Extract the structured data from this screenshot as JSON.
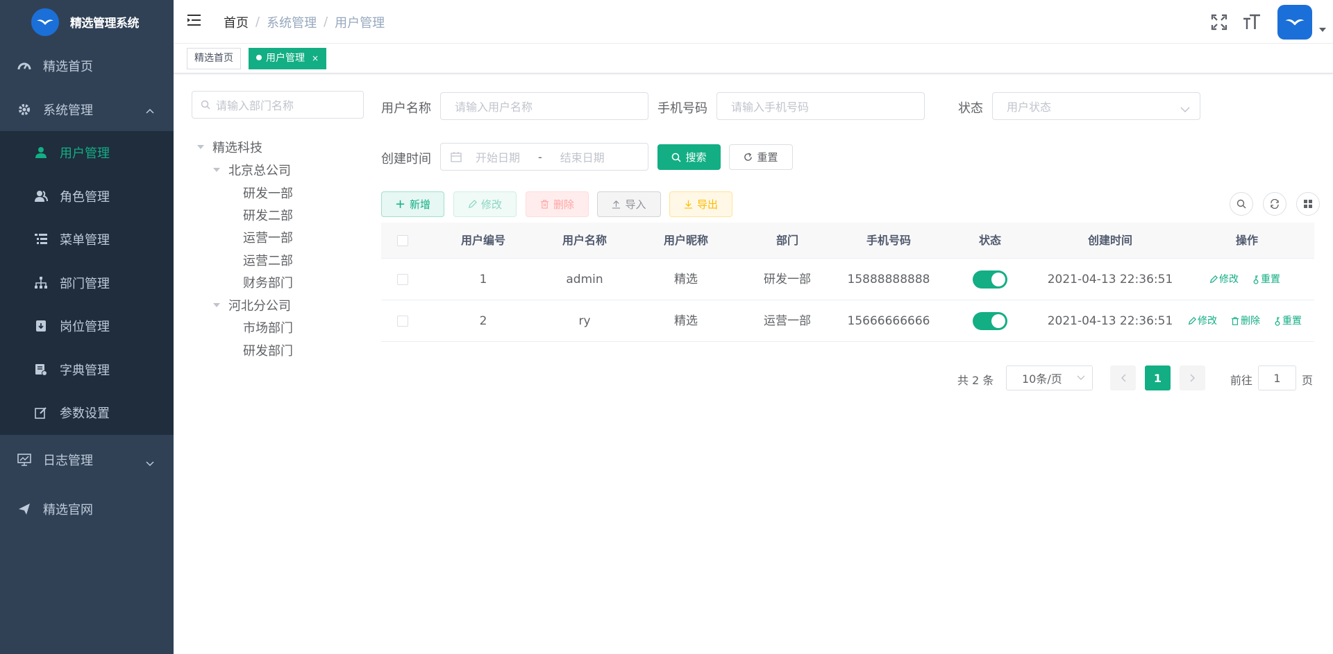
{
  "app": {
    "title": "精选管理系统"
  },
  "sidebar": {
    "items": [
      {
        "label": "精选首页",
        "icon": "dashboard-icon"
      },
      {
        "label": "系统管理",
        "icon": "gear-icon",
        "expanded": true,
        "children": [
          {
            "label": "用户管理",
            "icon": "user-icon",
            "active": true
          },
          {
            "label": "角色管理",
            "icon": "peoples-icon"
          },
          {
            "label": "菜单管理",
            "icon": "tree-table-icon"
          },
          {
            "label": "部门管理",
            "icon": "tree-icon"
          },
          {
            "label": "岗位管理",
            "icon": "post-icon"
          },
          {
            "label": "字典管理",
            "icon": "dict-icon"
          },
          {
            "label": "参数设置",
            "icon": "edit-icon"
          }
        ]
      },
      {
        "label": "日志管理",
        "icon": "log-icon",
        "expanded": false
      },
      {
        "label": "精选官网",
        "icon": "send-icon"
      }
    ]
  },
  "navbar": {
    "breadcrumb": [
      "首页",
      "系统管理",
      "用户管理"
    ]
  },
  "tags": [
    {
      "label": "精选首页",
      "active": false
    },
    {
      "label": "用户管理",
      "active": true,
      "close": "×"
    }
  ],
  "dept": {
    "search_placeholder": "请输入部门名称",
    "tree": {
      "root": "精选科技",
      "beijing": "北京总公司",
      "bj1": "研发一部",
      "bj2": "研发二部",
      "bj3": "运营一部",
      "bj4": "运营二部",
      "bj5": "财务部门",
      "hebei": "河北分公司",
      "hb1": "市场部门",
      "hb2": "研发部门"
    }
  },
  "query": {
    "username_label": "用户名称",
    "username_placeholder": "请输入用户名称",
    "phone_label": "手机号码",
    "phone_placeholder": "请输入手机号码",
    "status_label": "状态",
    "status_placeholder": "用户状态",
    "time_label": "创建时间",
    "start_placeholder": "开始日期",
    "range_sep": "-",
    "end_placeholder": "结束日期",
    "search_btn": "搜索",
    "reset_btn": "重置"
  },
  "toolbar": {
    "add": "新增",
    "edit": "修改",
    "delete": "删除",
    "import": "导入",
    "export": "导出"
  },
  "table": {
    "columns": [
      "用户编号",
      "用户名称",
      "用户昵称",
      "部门",
      "手机号码",
      "状态",
      "创建时间",
      "操作"
    ],
    "rows": [
      {
        "id": "1",
        "username": "admin",
        "nickname": "精选",
        "dept": "研发一部",
        "phone": "15888888888",
        "status": true,
        "created": "2021-04-13 22:36:51",
        "ops": [
          "修改",
          "重置"
        ]
      },
      {
        "id": "2",
        "username": "ry",
        "nickname": "精选",
        "dept": "运营一部",
        "phone": "15666666666",
        "status": true,
        "created": "2021-04-13 22:36:51",
        "ops": [
          "修改",
          "删除",
          "重置"
        ]
      }
    ]
  },
  "pagination": {
    "total": "共 2 条",
    "page_size": "10条/页",
    "current": "1",
    "goto_label": "前往",
    "goto_value": "1",
    "page_suffix": "页"
  },
  "colors": {
    "primary": "#13ae84",
    "sidebar_bg": "#304156",
    "submenu_bg": "#1f2d3d",
    "brand_blue": "#1b6fd8",
    "danger": "#ff4949",
    "warning": "#ffba00"
  }
}
